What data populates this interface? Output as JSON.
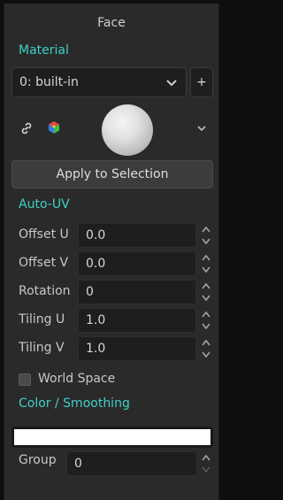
{
  "panel": {
    "title": "Face"
  },
  "material": {
    "section_label": "Material",
    "selected": "0: built-in",
    "add_label": "+",
    "apply_label": "Apply to Selection",
    "link_icon": "link-icon",
    "cube_icon": "cube-icon",
    "expand_icon": "chevron-down-icon"
  },
  "auto_uv": {
    "section_label": "Auto-UV",
    "fields": [
      {
        "label": "Offset U",
        "value": "0.0"
      },
      {
        "label": "Offset V",
        "value": "0.0"
      },
      {
        "label": "Rotation",
        "value": "0"
      },
      {
        "label": "Tiling U",
        "value": "1.0"
      },
      {
        "label": "Tiling V",
        "value": "1.0"
      }
    ],
    "world_space_label": "World Space",
    "world_space_checked": false
  },
  "color_smoothing": {
    "section_label": "Color / Smoothing",
    "color": "#ffffff",
    "group_label": "Group",
    "group_value": "0"
  },
  "colors": {
    "accent": "#3fd0c8",
    "panel_bg": "#2a2a2a",
    "field_bg": "#1e1e1e"
  }
}
